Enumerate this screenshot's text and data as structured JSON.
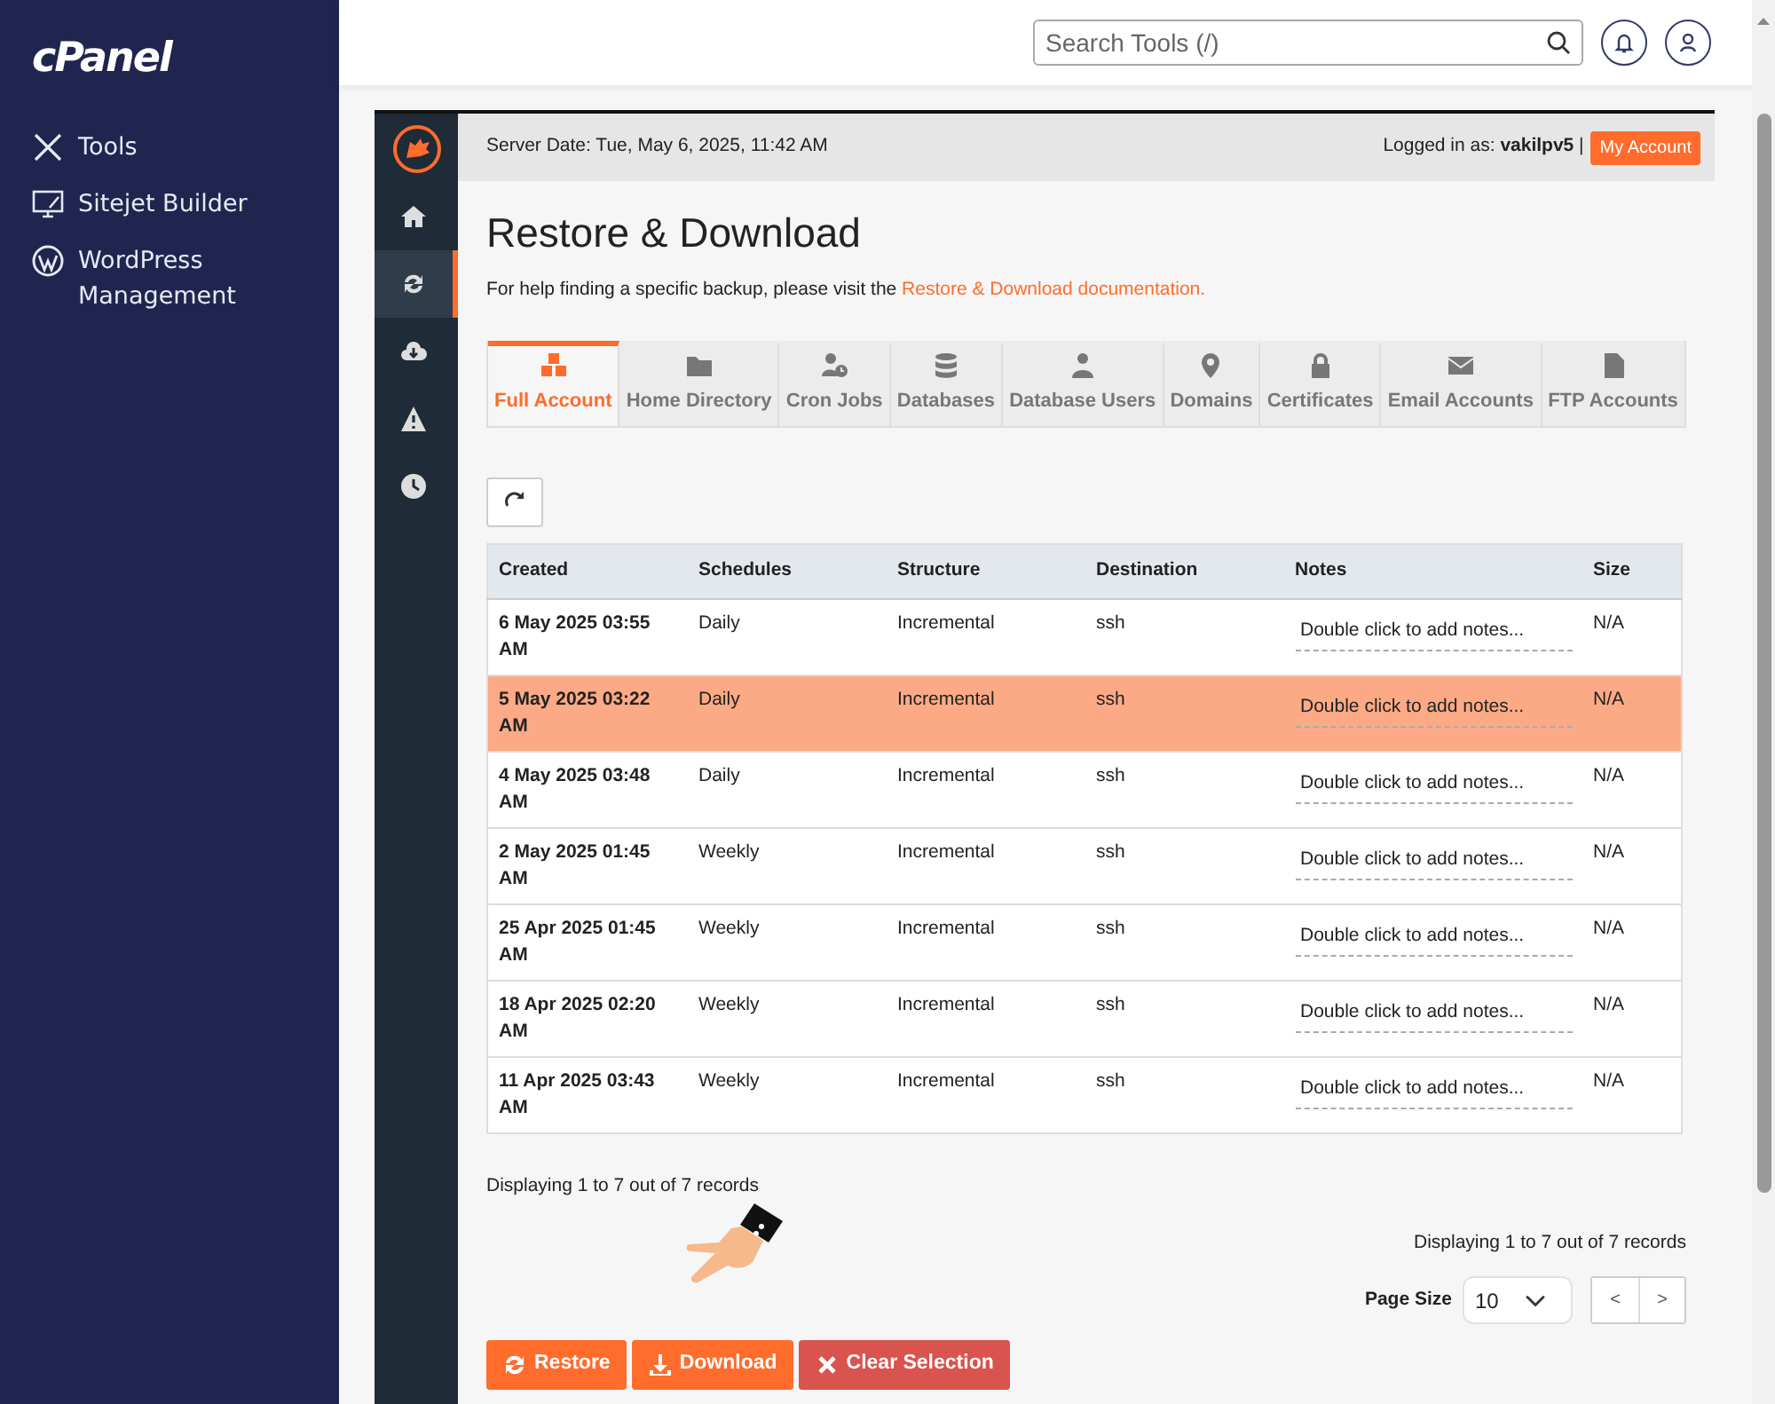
{
  "sidebar": {
    "logo": "cPanel",
    "items": [
      {
        "label": "Tools"
      },
      {
        "label": "Sitejet Builder"
      },
      {
        "label": "WordPress Management"
      }
    ]
  },
  "header": {
    "search": {
      "placeholder": "Search Tools (/)"
    }
  },
  "app_nav": {
    "items": [
      {
        "selected": false
      },
      {
        "selected": true
      },
      {
        "selected": false
      },
      {
        "selected": false
      },
      {
        "selected": false
      }
    ]
  },
  "topbar": {
    "server_date": "Server Date: Tue, May 6, 2025, 11:42 AM",
    "logged_in_label": "Logged in as:",
    "username": "vakilpv5",
    "separator": "|",
    "account_button": "My Account"
  },
  "title": "Restore & Download",
  "help": {
    "text": "For help finding a specific backup, please visit the",
    "link": "Restore & Download documentation."
  },
  "tabs": [
    {
      "label": "Full Account",
      "selected": true
    },
    {
      "label": "Home Directory",
      "selected": false
    },
    {
      "label": "Cron Jobs",
      "selected": false
    },
    {
      "label": "Databases",
      "selected": false
    },
    {
      "label": "Database Users",
      "selected": false
    },
    {
      "label": "Domains",
      "selected": false
    },
    {
      "label": "Certificates",
      "selected": false
    },
    {
      "label": "Email Accounts",
      "selected": false
    },
    {
      "label": "FTP Accounts",
      "selected": false
    }
  ],
  "table": {
    "columns": [
      "Created",
      "Schedules",
      "Structure",
      "Destination",
      "Notes",
      "Size"
    ],
    "rows": [
      {
        "selected": false,
        "created": "6 May 2025 03:55 AM",
        "schedules": "Daily",
        "structure": "Incremental",
        "destination": "ssh",
        "notes": "Double click to add notes...",
        "size": "N/A"
      },
      {
        "selected": true,
        "created": "5 May 2025 03:22 AM",
        "schedules": "Daily",
        "structure": "Incremental",
        "destination": "ssh",
        "notes": "Double click to add notes...",
        "size": "N/A"
      },
      {
        "selected": false,
        "created": "4 May 2025 03:48 AM",
        "schedules": "Daily",
        "structure": "Incremental",
        "destination": "ssh",
        "notes": "Double click to add notes...",
        "size": "N/A"
      },
      {
        "selected": false,
        "created": "2 May 2025 01:45 AM",
        "schedules": "Weekly",
        "structure": "Incremental",
        "destination": "ssh",
        "notes": "Double click to add notes...",
        "size": "N/A"
      },
      {
        "selected": false,
        "created": "25 Apr 2025 01:45 AM",
        "schedules": "Weekly",
        "structure": "Incremental",
        "destination": "ssh",
        "notes": "Double click to add notes...",
        "size": "N/A"
      },
      {
        "selected": false,
        "created": "18 Apr 2025 02:20 AM",
        "schedules": "Weekly",
        "structure": "Incremental",
        "destination": "ssh",
        "notes": "Double click to add notes...",
        "size": "N/A"
      },
      {
        "selected": false,
        "created": "11 Apr 2025 03:43 AM",
        "schedules": "Weekly",
        "structure": "Incremental",
        "destination": "ssh",
        "notes": "Double click to add notes...",
        "size": "N/A"
      }
    ]
  },
  "records_top": "Displaying 1 to 7 out of 7 records",
  "records_bottom": "Displaying 1 to 7 out of 7 records",
  "page_size": {
    "label": "Page Size",
    "value": "10"
  },
  "pager": {
    "prev": "<",
    "next": ">"
  },
  "actions": [
    {
      "kind": "restore",
      "label": "Restore"
    },
    {
      "kind": "download",
      "label": "Download"
    },
    {
      "kind": "clear",
      "label": "Clear Selection"
    }
  ]
}
